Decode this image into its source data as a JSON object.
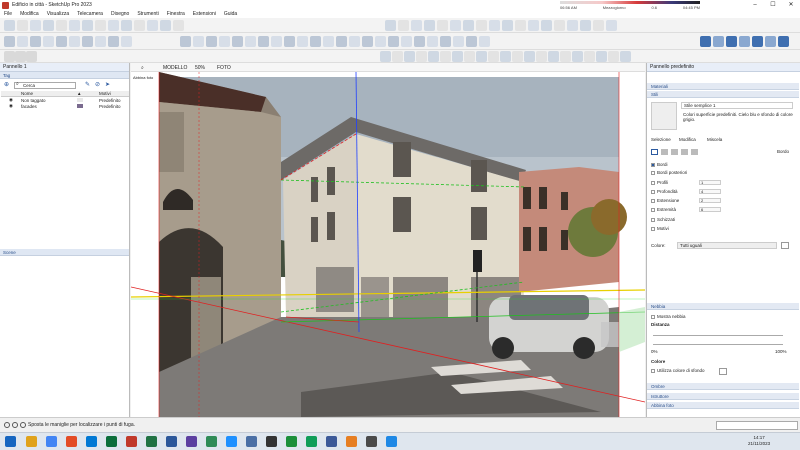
{
  "window": {
    "title": "Edificio in città - SketchUp Pro 2023",
    "shadow_time_start": "06:56 AM",
    "shadow_time_mid": "Mezzogiorno",
    "shadow_time_end": "04:45 PM",
    "shadow_value": "0.6"
  },
  "menu": [
    "File",
    "Modifica",
    "Visualizza",
    "Telecamera",
    "Disegno",
    "Strumenti",
    "Finestra",
    "Estensioni",
    "Guida"
  ],
  "left_panel": {
    "title": "Pannello 1",
    "tags_section": "Tag",
    "search_placeholder": "Cerca",
    "columns": {
      "name": "Nome",
      "line": "Motivi"
    },
    "tags": [
      {
        "name": "Non taggato",
        "line": "Predefinito",
        "color": "#e8e8e8"
      },
      {
        "name": "facades",
        "line": "Predefinito",
        "color": "#7a6b8f"
      }
    ],
    "scenes_section": "Scene"
  },
  "viewport": {
    "tab_model": "MODELLO",
    "zoom": "50%",
    "tab_photo": "FOTO",
    "photo_label": "Abbina foto"
  },
  "right_panel": {
    "title": "Pannello predefinito",
    "materials_section": "Materiali",
    "styles_section": "Stili",
    "style_name": "Stile semplice 1",
    "style_desc": "Colori superficie predefiniti. Cielo blu e sfondo di colore grigio.",
    "tabs": [
      "Selezione",
      "Modifica",
      "Miscela"
    ],
    "edges_label": "Bordo",
    "edge_options": [
      {
        "label": "Bordi",
        "checked": true,
        "value": ""
      },
      {
        "label": "Bordi posteriori",
        "checked": false,
        "value": ""
      },
      {
        "label": "Profili",
        "checked": false,
        "value": "1"
      },
      {
        "label": "Profondità",
        "checked": false,
        "value": "4"
      },
      {
        "label": "Estensione",
        "checked": false,
        "value": "2"
      },
      {
        "label": "Estremità",
        "checked": false,
        "value": "6"
      },
      {
        "label": "Schizzati",
        "checked": false,
        "value": ""
      },
      {
        "label": "Motivi",
        "checked": false,
        "value": ""
      }
    ],
    "color_label": "Colore:",
    "color_option": "Tutti uguali",
    "fog_section": "Nebbia",
    "fog_show": "Mostra nebbia",
    "distance_label": "Distanza",
    "distance_min": "0%",
    "distance_max": "100%",
    "color_section": "Colore",
    "fog_use_bg": "Utilizza colore di sfondo",
    "shadows_section": "Ombre",
    "instructor_section": "Istruttore",
    "match_photo_section": "Abbina foto"
  },
  "statusbar": {
    "message": "Sposta le maniglie per localizzare i punti di fuga."
  },
  "taskbar": {
    "time": "14:17",
    "date": "21/11/2023"
  },
  "colors": {
    "accent": "#2c5aa0",
    "axis_red": "#e02020",
    "axis_green": "#1fbf1f",
    "axis_blue": "#2040ff",
    "horizon": "#e8d000"
  }
}
